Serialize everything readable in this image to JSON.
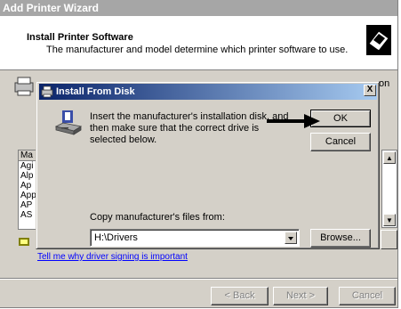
{
  "wizard": {
    "title": "Add Printer Wizard",
    "header_title": "Install Printer Software",
    "header_subtitle": "The manufacturer and model determine which printer software to use.",
    "background_fragment_text": "on",
    "list_header": "Ma",
    "list_items": [
      "Agi",
      "Alp",
      "Ap",
      "App",
      "AP",
      "AS"
    ],
    "link_text": "Tell me why driver signing is important",
    "buttons": {
      "back": "< Back",
      "next": "Next >",
      "cancel": "Cancel"
    }
  },
  "dialog": {
    "title": "Install From Disk",
    "close_glyph": "X",
    "message": "Insert the manufacturer's installation disk, and then make sure that the correct drive is selected below.",
    "ok_label": "OK",
    "cancel_label": "Cancel",
    "copy_label": "Copy manufacturer's files from:",
    "path_value": "H:\\Drivers",
    "browse_label": "Browse..."
  },
  "icons": {
    "header": "printer-icon",
    "disk": "install-disk-icon",
    "annotation": "arrow-icon"
  },
  "colors": {
    "dialog_face": "#d4d0c8",
    "title_active": "#0a246a",
    "title_inactive": "#a6a6a6",
    "link": "#0000ff"
  }
}
